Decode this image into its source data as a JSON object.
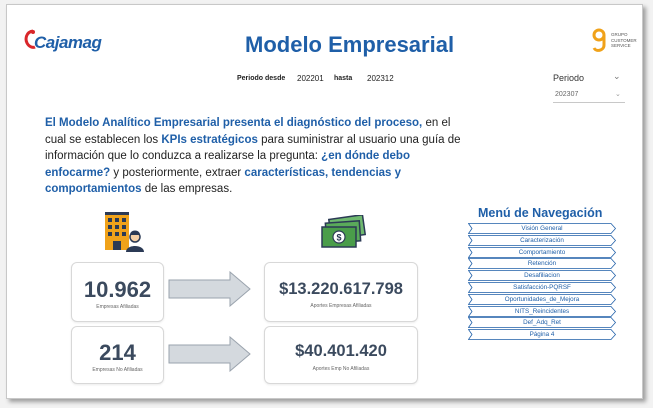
{
  "header": {
    "logo_text": "Cajamag",
    "title": "Modelo Empresarial",
    "partner_logo_text": "Grupo Customer Service"
  },
  "filters": {
    "from_label": "Periodo desde",
    "from_value": "202201",
    "to_label": "hasta",
    "to_value": "202312"
  },
  "slicer": {
    "title": "Periodo",
    "selected": "202307"
  },
  "description": {
    "p1": "El Modelo Analítico Empresarial presenta el diagnóstico del proceso,",
    "p2": " en el cual se establecen los ",
    "p3": "KPIs estratégicos",
    "p4": "  para suministrar al usuario una guía de información que lo conduzca a realizarse la pregunta: ",
    "p5": "¿en dónde debo enfocarme?",
    "p6": " y posteriormente, extraer ",
    "p7": "características, tendencias y comportamientos",
    "p8": " de las empresas."
  },
  "kpis": {
    "affiliated_count": "10.962",
    "affiliated_count_label": "Empresas Afiliadas",
    "affiliated_contrib": "$13.220.617.798",
    "affiliated_contrib_label": "Aportes Empresas Afiliadas",
    "non_affiliated_count": "214",
    "non_affiliated_count_label": "Empresas No Afiliadas",
    "non_affiliated_contrib": "$40.401.420",
    "non_affiliated_contrib_label": "Aportes Emp No Afiliadas"
  },
  "nav": {
    "title": "Menú de Navegación",
    "items": [
      {
        "label": "Visión General"
      },
      {
        "label": "Caracterización"
      },
      {
        "label": "Comportamiento"
      },
      {
        "label": "Retención"
      },
      {
        "label": "Desafiliacion"
      },
      {
        "label": "Satisfacción-PQRSF"
      },
      {
        "label": "Oportunidades_de_Mejora"
      },
      {
        "label": "NITS_Reincidentes"
      },
      {
        "label": "Def_Adq_Ret"
      },
      {
        "label": "Página 4"
      }
    ]
  },
  "colors": {
    "brand_blue": "#1f5fa8",
    "kpi_text": "#3b4a5e",
    "money_green": "#4a9d4a",
    "building_orange": "#f0a21a"
  },
  "icons": [
    "building-icon",
    "money-icon",
    "arrow-right-icon"
  ]
}
